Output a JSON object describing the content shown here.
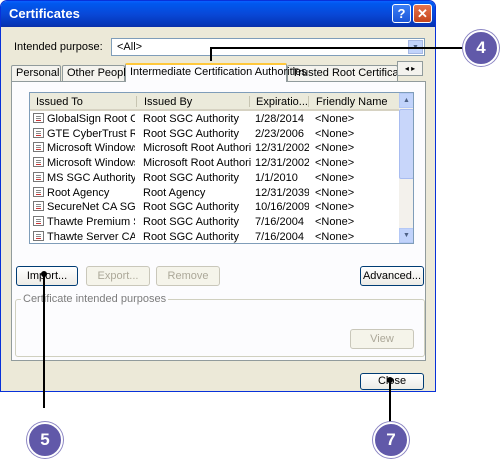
{
  "window": {
    "title": "Certificates",
    "help_label": "?",
    "close_glyph": "✕"
  },
  "purpose": {
    "label": "Intended purpose:",
    "value": "<All>"
  },
  "tabs": [
    {
      "label": "Personal"
    },
    {
      "label": "Other People"
    },
    {
      "label": "Intermediate Certification Authorities"
    },
    {
      "label": "Trusted Root Certification"
    }
  ],
  "tab_scroll": "◂ ▸",
  "list": {
    "columns": [
      "Issued To",
      "Issued By",
      "Expiratio...",
      "Friendly Name"
    ],
    "rows": [
      {
        "to": "GlobalSign Root CA",
        "by": "Root SGC Authority",
        "exp": "1/28/2014",
        "name": "<None>"
      },
      {
        "to": "GTE CyberTrust Root",
        "by": "Root SGC Authority",
        "exp": "2/23/2006",
        "name": "<None>"
      },
      {
        "to": "Microsoft Windows ...",
        "by": "Microsoft Root Authority",
        "exp": "12/31/2002",
        "name": "<None>"
      },
      {
        "to": "Microsoft Windows ...",
        "by": "Microsoft Root Authority",
        "exp": "12/31/2002",
        "name": "<None>"
      },
      {
        "to": "MS SGC Authority",
        "by": "Root SGC Authority",
        "exp": "1/1/2010",
        "name": "<None>"
      },
      {
        "to": "Root Agency",
        "by": "Root Agency",
        "exp": "12/31/2039",
        "name": "<None>"
      },
      {
        "to": "SecureNet CA SGC ...",
        "by": "Root SGC Authority",
        "exp": "10/16/2009",
        "name": "<None>"
      },
      {
        "to": "Thawte Premium Se...",
        "by": "Root SGC Authority",
        "exp": "7/16/2004",
        "name": "<None>"
      },
      {
        "to": "Thawte Server CA",
        "by": "Root SGC Authority",
        "exp": "7/16/2004",
        "name": "<None>"
      }
    ]
  },
  "buttons": {
    "import": "Import...",
    "export": "Export...",
    "remove": "Remove",
    "advanced": "Advanced...",
    "view": "View",
    "close": "Close"
  },
  "purposes_group": "Certificate intended purposes",
  "callouts": {
    "four": "4",
    "five": "5",
    "seven": "7"
  },
  "colors": {
    "callout": "#6159a9",
    "titlebar": "#0848d8"
  }
}
